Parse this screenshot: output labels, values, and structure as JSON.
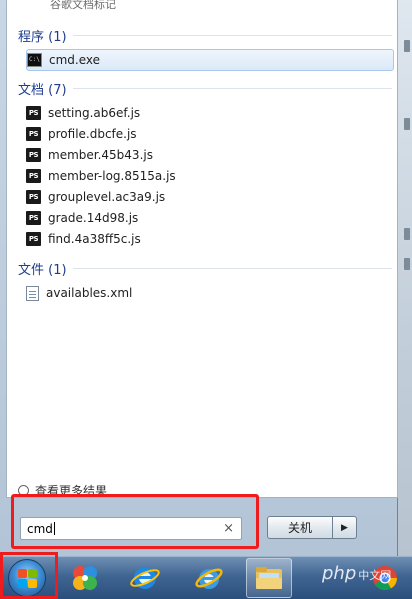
{
  "clipped_top_text": "谷歌文档标记",
  "sections": [
    {
      "title": "程序 (1)",
      "items": [
        {
          "icon": "cmd-icon",
          "label": "cmd.exe",
          "selected": true
        }
      ]
    },
    {
      "title": "文档 (7)",
      "items": [
        {
          "icon": "ps-file-icon",
          "label": "setting.ab6ef.js"
        },
        {
          "icon": "ps-file-icon",
          "label": "profile.dbcfe.js"
        },
        {
          "icon": "ps-file-icon",
          "label": "member.45b43.js"
        },
        {
          "icon": "ps-file-icon",
          "label": "member-log.8515a.js"
        },
        {
          "icon": "ps-file-icon",
          "label": "grouplevel.ac3a9.js"
        },
        {
          "icon": "ps-file-icon",
          "label": "grade.14d98.js"
        },
        {
          "icon": "ps-file-icon",
          "label": "find.4a38ff5c.js"
        }
      ]
    },
    {
      "title": "文件 (1)",
      "items": [
        {
          "icon": "xml-file-icon",
          "label": "availables.xml"
        }
      ]
    }
  ],
  "see_more": "查看更多结果",
  "search": {
    "value": "cmd",
    "clear": "×"
  },
  "shutdown": {
    "label": "关机",
    "arrow": "▶"
  },
  "taskbar": {
    "items": [
      "start-orb",
      "photo-app",
      "internet-explorer",
      "ie-browser",
      "file-explorer",
      "php-cn",
      "chrome"
    ],
    "watermark": "php",
    "watermark_suffix": "中文网"
  },
  "colors": {
    "highlight": "#ee1c1c",
    "section_title": "#1e3d8f"
  }
}
